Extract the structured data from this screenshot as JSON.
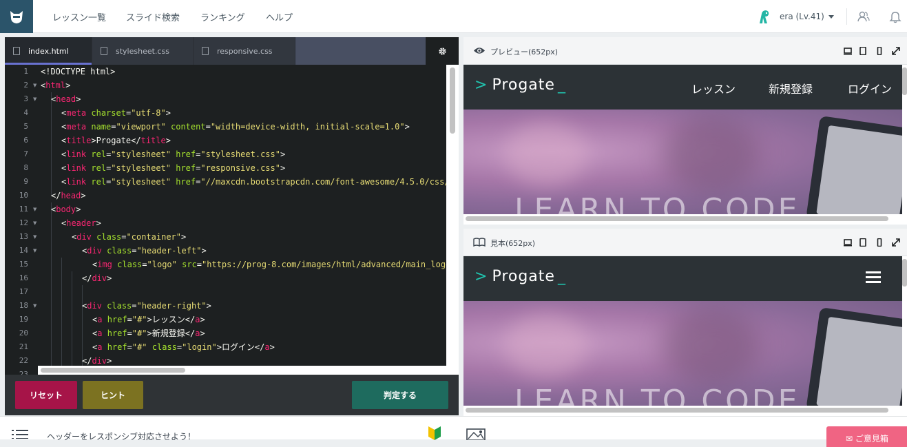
{
  "topnav": {
    "links": [
      "レッスン一覧",
      "スライド検索",
      "ランキング",
      "ヘルプ"
    ],
    "user": "era (Lv.41)",
    "icons": [
      "progate-ninja-logo",
      "user-avatar-icon",
      "friends-icon",
      "bell-icon"
    ]
  },
  "editor": {
    "tabs": [
      "index.html",
      "stylesheet.css",
      "responsive.css"
    ],
    "line_numbers": [
      "1",
      "2",
      "3",
      "4",
      "5",
      "6",
      "7",
      "8",
      "9",
      "10",
      "11",
      "12",
      "13",
      "14",
      "15",
      "16",
      "17",
      "18",
      "19",
      "20",
      "21",
      "22",
      "23"
    ],
    "buttons": {
      "reset": "リセット",
      "hint": "ヒント",
      "judge": "判定する"
    },
    "colors": {
      "reset": "#a61448",
      "hint": "#7c7221",
      "judge": "#1e6b5e",
      "tab_accent": "#6972d1"
    }
  },
  "preview": {
    "title": "プレビュー(652px)",
    "logo": "Progate",
    "nav": [
      "レッスン",
      "新規登録",
      "ログイン"
    ],
    "hero_text": "LEARN TO CODE"
  },
  "sample": {
    "title": "見本(652px)",
    "logo": "Progate",
    "hero_text": "LEARN TO CODE"
  },
  "bottom": {
    "mission": "ヘッダーをレスポンシブ対応させよう！",
    "quiz": "ご意見箱"
  }
}
